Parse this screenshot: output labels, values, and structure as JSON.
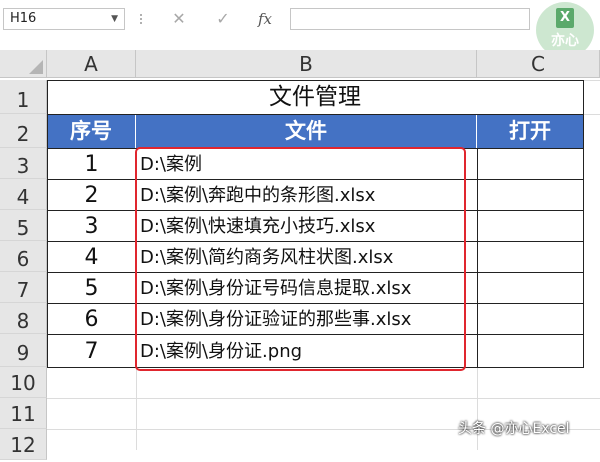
{
  "formula_bar": {
    "name_box": "H16",
    "cancel_symbol": "✕",
    "enter_symbol": "✓",
    "fx_label": "fx"
  },
  "logo": {
    "text": "亦心"
  },
  "columns": [
    "A",
    "B",
    "C"
  ],
  "rows": [
    "1",
    "2",
    "3",
    "4",
    "5",
    "6",
    "7",
    "8",
    "9",
    "10",
    "11",
    "12"
  ],
  "sheet": {
    "title": "文件管理",
    "headers": {
      "seq": "序号",
      "file": "文件",
      "open": "打开"
    },
    "records": [
      {
        "seq": "1",
        "file": "D:\\案例"
      },
      {
        "seq": "2",
        "file": "D:\\案例\\奔跑中的条形图.xlsx"
      },
      {
        "seq": "3",
        "file": "D:\\案例\\快速填充小技巧.xlsx"
      },
      {
        "seq": "4",
        "file": "D:\\案例\\简约商务风柱状图.xlsx"
      },
      {
        "seq": "5",
        "file": "D:\\案例\\身份证号码信息提取.xlsx"
      },
      {
        "seq": "6",
        "file": "D:\\案例\\身份证验证的那些事.xlsx"
      },
      {
        "seq": "7",
        "file": "D:\\案例\\身份证.png"
      }
    ]
  },
  "watermark": "头条 @亦心Excel",
  "colors": {
    "header_fill": "#4472c4",
    "highlight_border": "#e0262e"
  }
}
